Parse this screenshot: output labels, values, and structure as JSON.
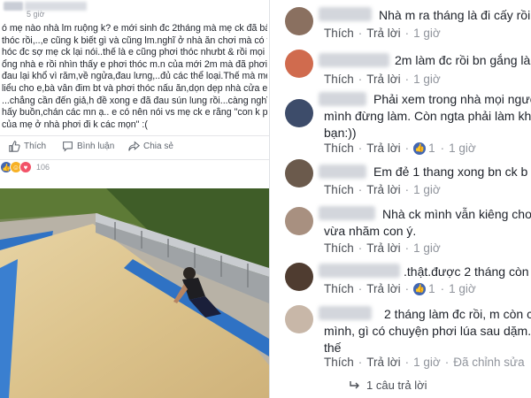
{
  "post": {
    "time": "5 giờ",
    "text_lines": [
      "ó mẹ nào nhà lm ruộng k? e mới sinh đc 2tháng mà mẹ ck đã bảo phơi",
      "thóc rồi,..,e cũng k biết gì và cũng lm.nghĩ ở nhà ăn chơi mà có vài tải thóc",
      "hóc đc sợ mẹ ck lại nói..thế là e cũng phơi thóc nhưbt & rồi mọi ng đi qa",
      "ổng nhà e rồi nhìn thấy e phơi thóc m.n của mới 2m mà đã phơi thóc về",
      "đau lại khổ vì răm,về ngửa,đau lưng,..đủ các thể loại.Thế mà mẹ ck e đâu",
      "liểu cho e,bà vẫn đim bt và phơi thóc nấu ăn,dọn dẹp nhà cửa e vẫn tải In",
      "...chẳng cần đến giả,h đề xong e đã đau sún lung rồi...càng nghĩ càng",
      "hấy buồn,chán các mn ạ.. e có nên nói vs mẹ ck e rằng \"con k phơi thóc",
      "của mẹ ở nhà phơi đi k các mọn\" :("
    ],
    "actions": {
      "like": "Thích",
      "comment": "Bình luận",
      "share": "Chia sẻ"
    },
    "reaction_count": "106"
  },
  "comments": [
    {
      "text": [
        "Nhà m ra tháng là đi cấy rồi ."
      ],
      "actions": {
        "like": "Thích",
        "reply": "Trả lời",
        "time": "1 giờ"
      }
    },
    {
      "text": [
        "2m làm đc rồi bn gắng làm"
      ],
      "actions": {
        "like": "Thích",
        "reply": "Trả lời",
        "time": "1 giờ"
      }
    },
    {
      "text": [
        "Phải xem trong nhà mọi người",
        "mình đừng làm. Còn ngta phải làm khô",
        "bạn:))"
      ],
      "actions": {
        "like": "Thích",
        "reply": "Trả lời",
        "likes": "1",
        "time": "1 giờ"
      }
    },
    {
      "text": [
        "Em đẻ 1 thang xong bn ck b"
      ],
      "actions": {
        "like": "Thích",
        "reply": "Trả lời",
        "time": "1 giờ"
      }
    },
    {
      "text": [
        "Nhà ck mình vẫn kiêng cho.",
        "vừa nhăm con ý."
      ],
      "actions": {
        "like": "Thích",
        "reply": "Trả lời",
        "time": "1 giờ"
      }
    },
    {
      "text": [
        ".thật.được 2 tháng còn k"
      ],
      "actions": {
        "like": "Thích",
        "reply": "Trả lời",
        "likes": "1",
        "time": "1 giờ"
      }
    },
    {
      "text": [
        "2 tháng làm đc rồi, m còn c",
        "mình, gì có chuyện phơi lúa sau dặm. E",
        "thế"
      ],
      "actions": {
        "like": "Thích",
        "reply": "Trả lời",
        "time": "1 giờ",
        "edited": "Đã chỉnh sửa"
      }
    }
  ],
  "replies": {
    "label": "1 câu trả lời"
  },
  "colors": {
    "like_blue": "#4267b2",
    "text": "#1d2129",
    "meta_gray": "#90949c",
    "tarp_blue": "#2f72c4"
  }
}
